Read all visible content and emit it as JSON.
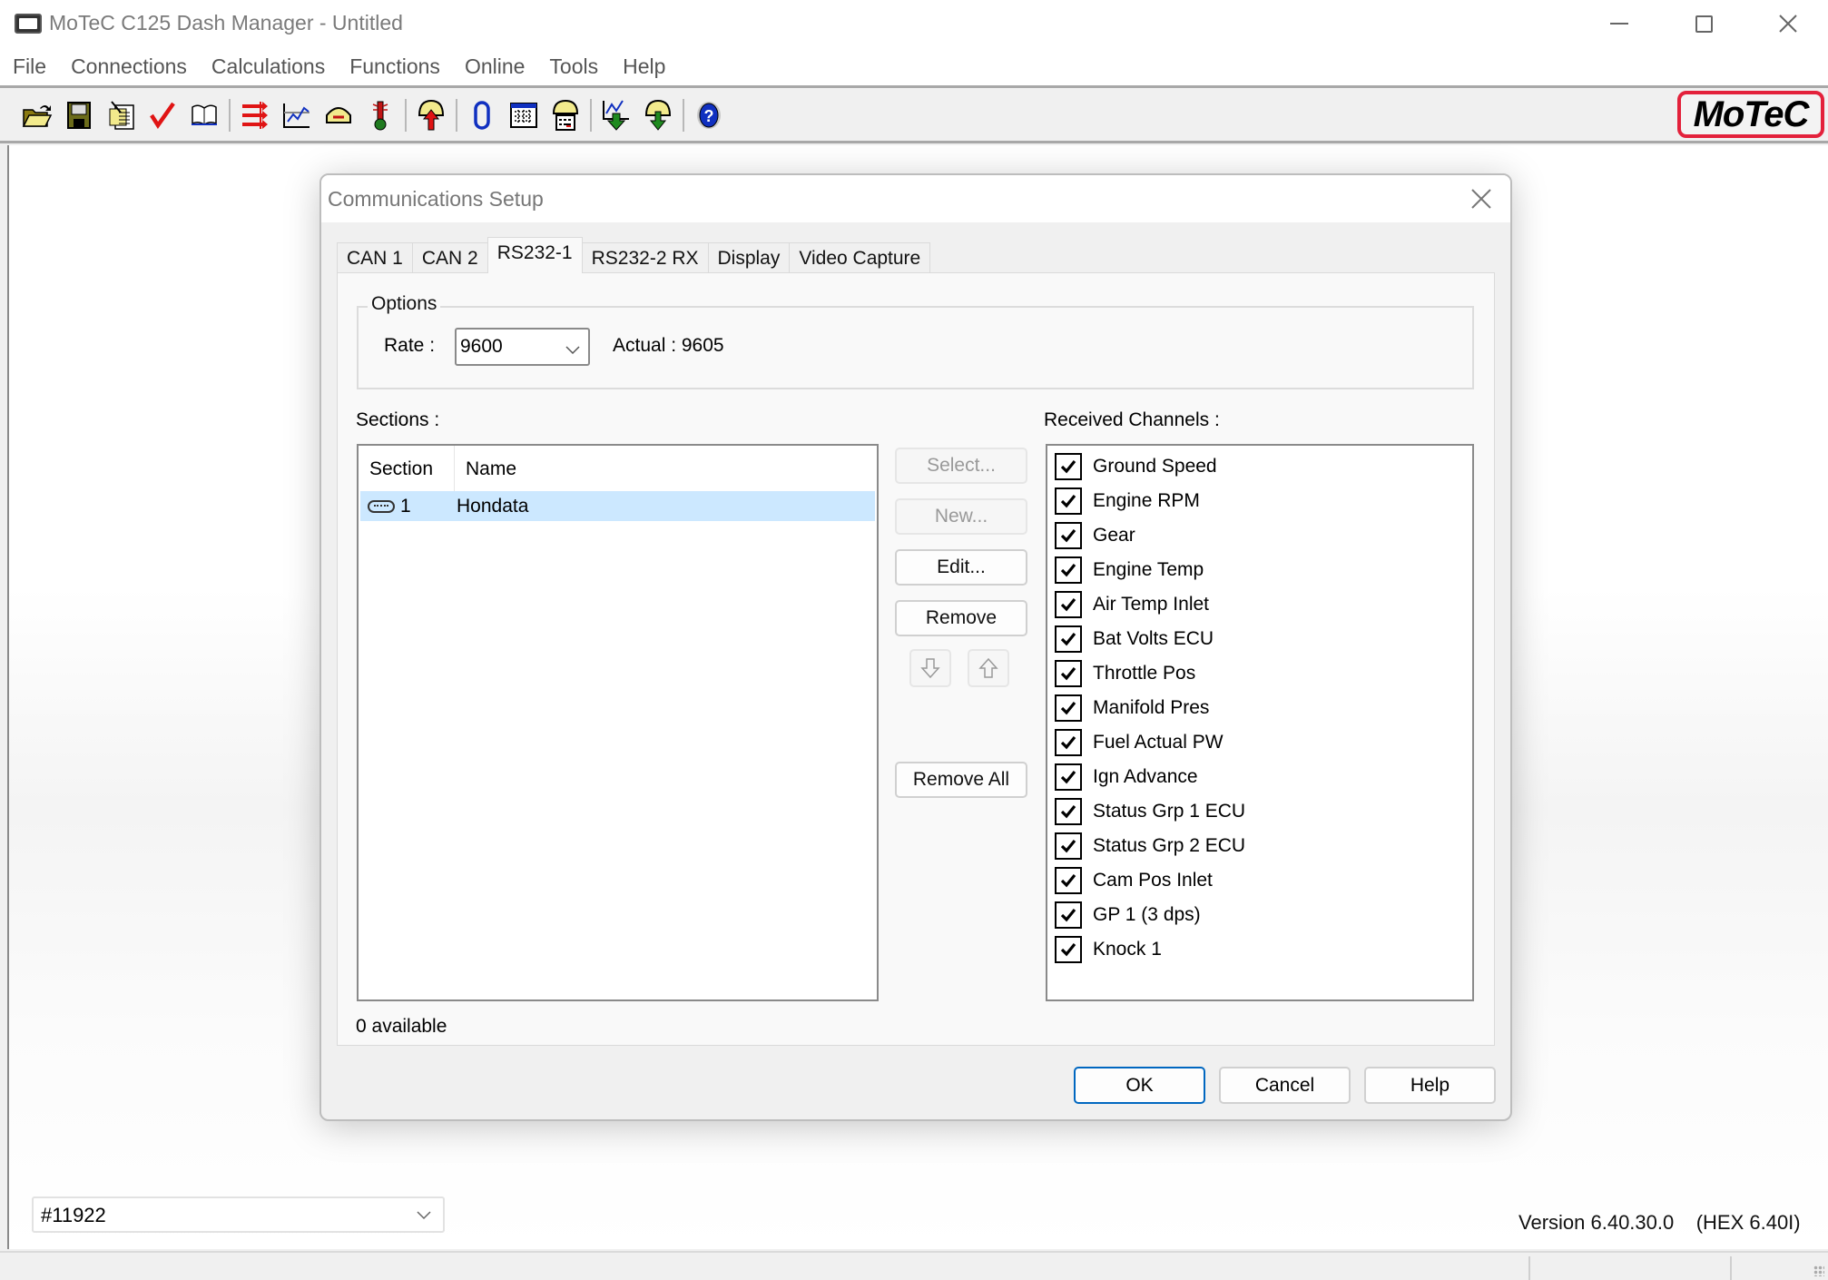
{
  "window": {
    "title": "MoTeC C125 Dash Manager - Untitled",
    "controls": [
      "minimize",
      "maximize",
      "close"
    ]
  },
  "menu": [
    "File",
    "Connections",
    "Calculations",
    "Functions",
    "Online",
    "Tools",
    "Help"
  ],
  "toolbar": {
    "icons": [
      "open-folder-icon",
      "save-disk-icon",
      "properties-document-icon",
      "check-icon",
      "book-icon",
      "channels-icon",
      "chart-icon",
      "display-icon",
      "thermometer-icon",
      "send-upload-icon",
      "zero-icon",
      "table-icon",
      "dash-config-icon",
      "get-logged-data-icon",
      "receive-download-icon",
      "help-icon"
    ],
    "brand": "MoTeC",
    "brand_color": "#e3213b"
  },
  "dialog": {
    "title": "Communications Setup",
    "tabs": [
      {
        "label": "CAN 1",
        "active": false
      },
      {
        "label": "CAN 2",
        "active": false
      },
      {
        "label": "RS232-1",
        "active": true
      },
      {
        "label": "RS232-2 RX",
        "active": false
      },
      {
        "label": "Display",
        "active": false
      },
      {
        "label": "Video Capture",
        "active": false
      }
    ],
    "options": {
      "group_label": "Options",
      "rate_label": "Rate :",
      "rate_value": "9600",
      "actual_label": "Actual : 9605"
    },
    "sections": {
      "label": "Sections :",
      "columns": [
        "Section",
        "Name"
      ],
      "rows": [
        {
          "section": "1",
          "name": "Hondata",
          "selected": true
        }
      ],
      "available_text": "0 available"
    },
    "section_buttons": {
      "select": "Select...",
      "new": "New...",
      "edit": "Edit...",
      "remove": "Remove",
      "move_down": "move-down",
      "move_up": "move-up",
      "remove_all": "Remove All"
    },
    "channels": {
      "label": "Received Channels :",
      "items": [
        {
          "name": "Ground Speed",
          "checked": true
        },
        {
          "name": "Engine RPM",
          "checked": true
        },
        {
          "name": "Gear",
          "checked": true
        },
        {
          "name": "Engine Temp",
          "checked": true
        },
        {
          "name": "Air Temp Inlet",
          "checked": true
        },
        {
          "name": "Bat Volts ECU",
          "checked": true
        },
        {
          "name": "Throttle Pos",
          "checked": true
        },
        {
          "name": "Manifold Pres",
          "checked": true
        },
        {
          "name": "Fuel Actual PW",
          "checked": true
        },
        {
          "name": "Ign Advance",
          "checked": true
        },
        {
          "name": "Status Grp 1 ECU",
          "checked": true
        },
        {
          "name": "Status Grp 2 ECU",
          "checked": true
        },
        {
          "name": "Cam Pos Inlet",
          "checked": true
        },
        {
          "name": "GP 1 (3 dps)",
          "checked": true
        },
        {
          "name": "Knock 1",
          "checked": true
        }
      ]
    },
    "footer": {
      "ok": "OK",
      "cancel": "Cancel",
      "help": "Help"
    }
  },
  "bottom": {
    "serial_value": "#11922",
    "version": "Version 6.40.30.0    (HEX 6.40I)"
  }
}
